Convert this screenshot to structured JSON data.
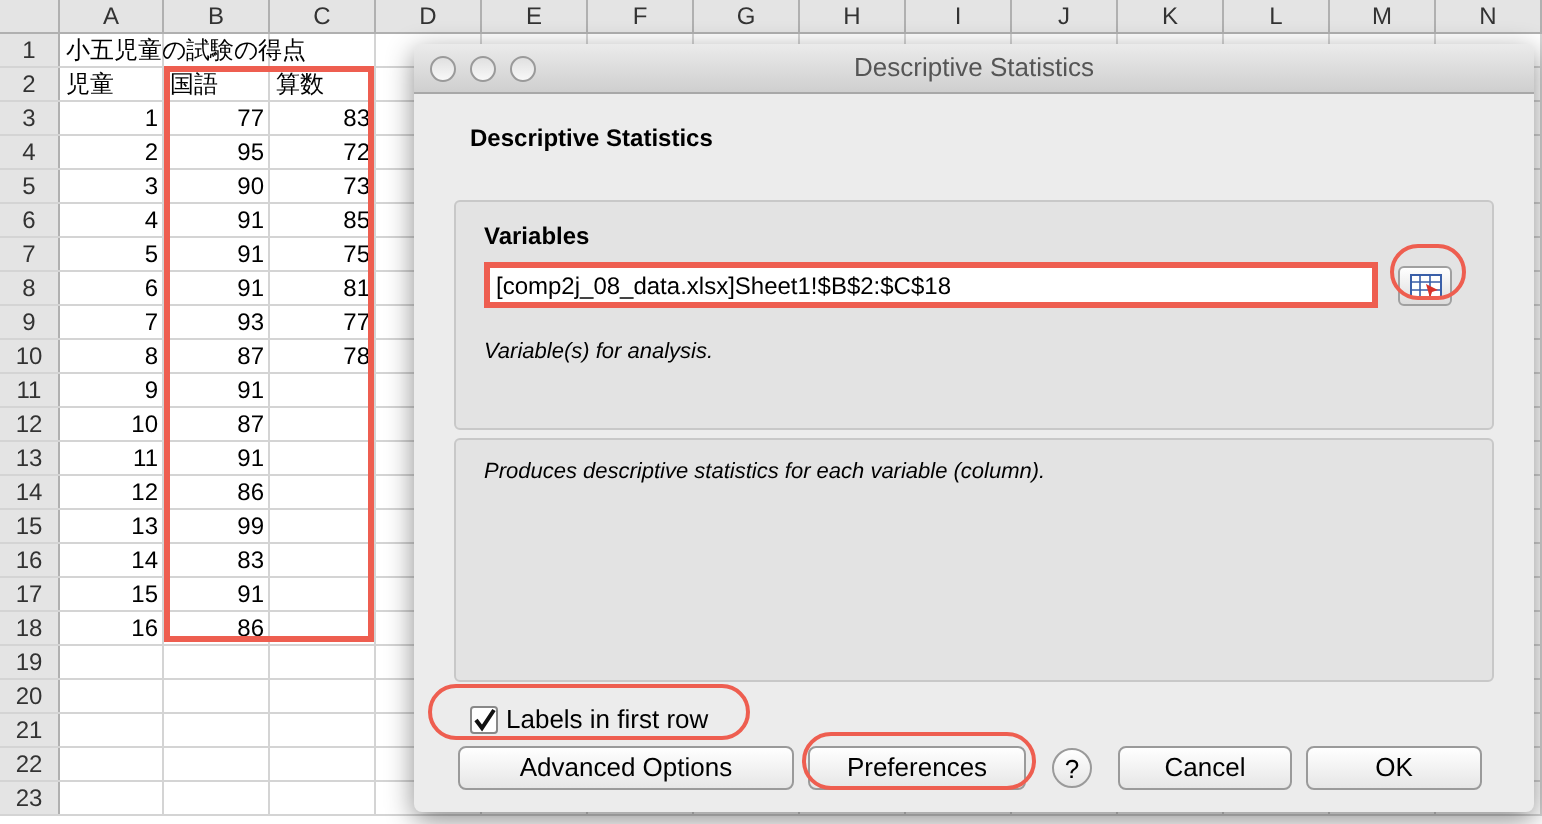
{
  "sheet": {
    "columns": [
      "A",
      "B",
      "C",
      "D",
      "E",
      "F",
      "G",
      "H",
      "I",
      "J",
      "K",
      "L",
      "M",
      "N"
    ],
    "rows": [
      {
        "number": "1",
        "cells": [
          {
            "text": "小五児童の試験の得点",
            "kind": "text"
          }
        ]
      },
      {
        "number": "2",
        "cells": [
          {
            "text": "児童",
            "kind": "text"
          },
          {
            "text": "国語",
            "kind": "text"
          },
          {
            "text": "算数",
            "kind": "text"
          }
        ]
      },
      {
        "number": "3",
        "cells": [
          {
            "text": "1",
            "kind": "number"
          },
          {
            "text": "77",
            "kind": "number"
          },
          {
            "text": "83",
            "kind": "number"
          }
        ]
      },
      {
        "number": "4",
        "cells": [
          {
            "text": "2",
            "kind": "number"
          },
          {
            "text": "95",
            "kind": "number"
          },
          {
            "text": "72",
            "kind": "number"
          }
        ]
      },
      {
        "number": "5",
        "cells": [
          {
            "text": "3",
            "kind": "number"
          },
          {
            "text": "90",
            "kind": "number"
          },
          {
            "text": "73",
            "kind": "number"
          }
        ]
      },
      {
        "number": "6",
        "cells": [
          {
            "text": "4",
            "kind": "number"
          },
          {
            "text": "91",
            "kind": "number"
          },
          {
            "text": "85",
            "kind": "number"
          }
        ]
      },
      {
        "number": "7",
        "cells": [
          {
            "text": "5",
            "kind": "number"
          },
          {
            "text": "91",
            "kind": "number"
          },
          {
            "text": "75",
            "kind": "number"
          }
        ]
      },
      {
        "number": "8",
        "cells": [
          {
            "text": "6",
            "kind": "number"
          },
          {
            "text": "91",
            "kind": "number"
          },
          {
            "text": "81",
            "kind": "number"
          }
        ]
      },
      {
        "number": "9",
        "cells": [
          {
            "text": "7",
            "kind": "number"
          },
          {
            "text": "93",
            "kind": "number"
          },
          {
            "text": "77",
            "kind": "number"
          }
        ]
      },
      {
        "number": "10",
        "cells": [
          {
            "text": "8",
            "kind": "number"
          },
          {
            "text": "87",
            "kind": "number"
          },
          {
            "text": "78",
            "kind": "number"
          }
        ]
      },
      {
        "number": "11",
        "cells": [
          {
            "text": "9",
            "kind": "number"
          },
          {
            "text": "91",
            "kind": "number"
          }
        ]
      },
      {
        "number": "12",
        "cells": [
          {
            "text": "10",
            "kind": "number"
          },
          {
            "text": "87",
            "kind": "number"
          }
        ]
      },
      {
        "number": "13",
        "cells": [
          {
            "text": "11",
            "kind": "number"
          },
          {
            "text": "91",
            "kind": "number"
          }
        ]
      },
      {
        "number": "14",
        "cells": [
          {
            "text": "12",
            "kind": "number"
          },
          {
            "text": "86",
            "kind": "number"
          }
        ]
      },
      {
        "number": "15",
        "cells": [
          {
            "text": "13",
            "kind": "number"
          },
          {
            "text": "99",
            "kind": "number"
          }
        ]
      },
      {
        "number": "16",
        "cells": [
          {
            "text": "14",
            "kind": "number"
          },
          {
            "text": "83",
            "kind": "number"
          }
        ]
      },
      {
        "number": "17",
        "cells": [
          {
            "text": "15",
            "kind": "number"
          },
          {
            "text": "91",
            "kind": "number"
          }
        ]
      },
      {
        "number": "18",
        "cells": [
          {
            "text": "16",
            "kind": "number"
          },
          {
            "text": "86",
            "kind": "number"
          }
        ]
      },
      {
        "number": "19",
        "cells": []
      },
      {
        "number": "20",
        "cells": []
      },
      {
        "number": "21",
        "cells": []
      },
      {
        "number": "22",
        "cells": []
      },
      {
        "number": "23",
        "cells": []
      }
    ]
  },
  "dialog": {
    "title": "Descriptive Statistics",
    "heading": "Descriptive Statistics",
    "variables": {
      "label": "Variables",
      "value": "[comp2j_08_data.xlsx]Sheet1!$B$2:$C$18",
      "hint": "Variable(s) for analysis."
    },
    "description": "Produces descriptive statistics for each variable (column).",
    "labels_checkbox": {
      "label": "Labels in first row",
      "checked": true
    },
    "buttons": [
      "Advanced Options",
      "Preferences",
      "?",
      "Cancel",
      "OK"
    ]
  }
}
